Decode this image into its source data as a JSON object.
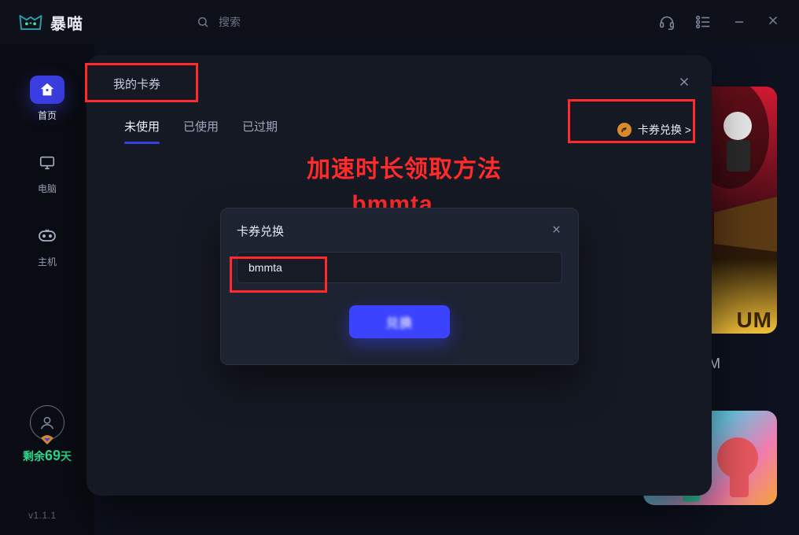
{
  "brand": "暴喵",
  "search": {
    "placeholder": "搜索"
  },
  "sidebar": {
    "items": [
      {
        "label": "首页"
      },
      {
        "label": "电脑"
      },
      {
        "label": "主机"
      }
    ],
    "remain_prefix": "剩余",
    "remain_days": "69",
    "remain_suffix": "天"
  },
  "version": "v1.1.1",
  "coupon_panel": {
    "title": "我的卡券",
    "tabs": [
      {
        "label": "未使用"
      },
      {
        "label": "已使用"
      },
      {
        "label": "已过期"
      }
    ],
    "exchange_label": "卡券兑换 >"
  },
  "guide": {
    "line1": "加速时长领取方法",
    "line2": "bmmta"
  },
  "modal": {
    "title": "卡券兑换",
    "input_value": "bmmta",
    "confirm_label": "兑换"
  },
  "game_letter": "M",
  "game_big_tag": "UM"
}
